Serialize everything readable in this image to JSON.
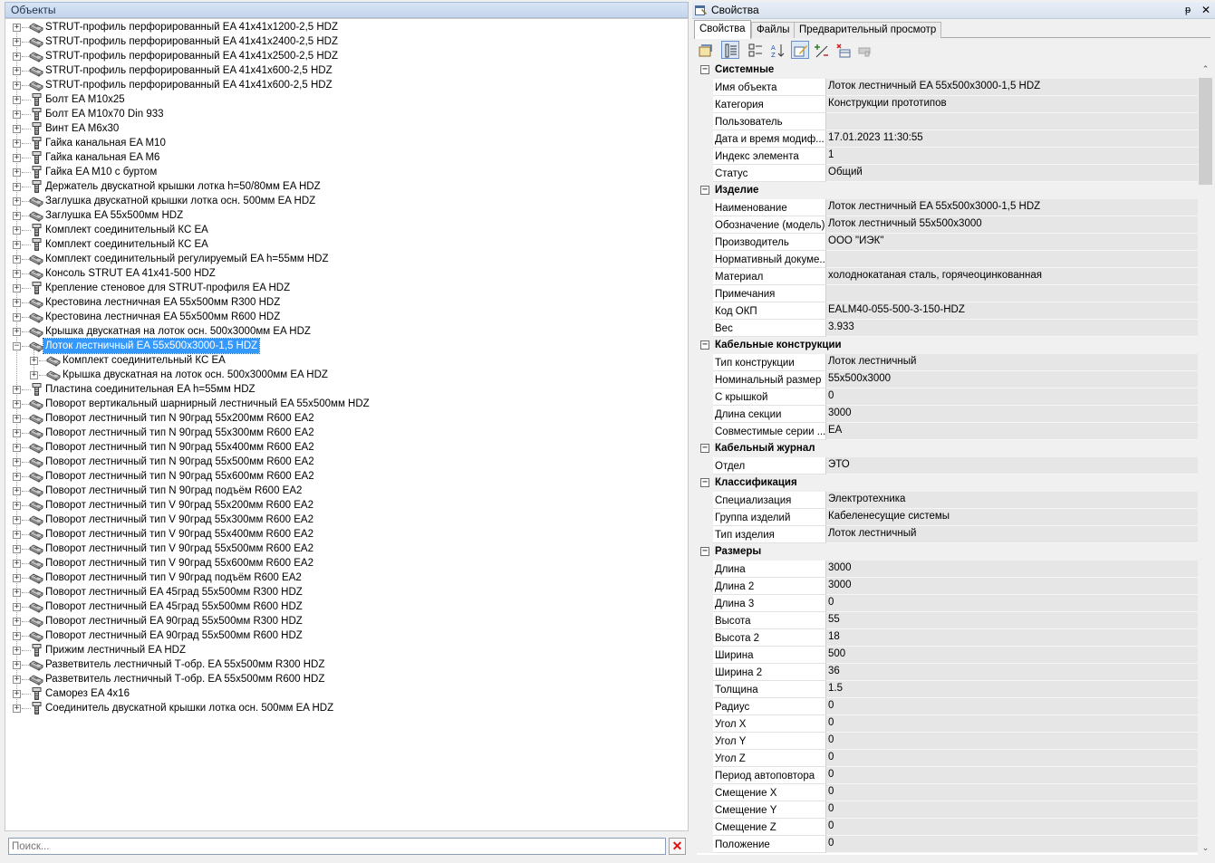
{
  "objects_panel": {
    "title": "Объекты",
    "search_placeholder": "Поиск...",
    "clear_symbol": "✕",
    "items": [
      {
        "label": "STRUT-профиль перфорированный EA 41x41x1200-2,5 HDZ",
        "icon": "profile-icon",
        "level": 0,
        "expand": "+"
      },
      {
        "label": "STRUT-профиль перфорированный EA 41x41x2400-2,5 HDZ",
        "icon": "profile-icon",
        "level": 0,
        "expand": "+"
      },
      {
        "label": "STRUT-профиль перфорированный EA 41x41x2500-2,5 HDZ",
        "icon": "profile-icon",
        "level": 0,
        "expand": "+"
      },
      {
        "label": "STRUT-профиль перфорированный EA 41x41x600-2,5 HDZ",
        "icon": "profile-icon",
        "level": 0,
        "expand": "+"
      },
      {
        "label": "STRUT-профиль перфорированный EA 41x41x600-2,5 HDZ",
        "icon": "profile-icon",
        "level": 0,
        "expand": "+"
      },
      {
        "label": "Болт EA M10x25",
        "icon": "fastener-icon",
        "level": 0,
        "expand": "+"
      },
      {
        "label": "Болт EA M10x70 Din  933",
        "icon": "fastener-icon",
        "level": 0,
        "expand": "+"
      },
      {
        "label": "Винт EA M6x30",
        "icon": "fastener-icon",
        "level": 0,
        "expand": "+"
      },
      {
        "label": "Гайка канальная EA M10",
        "icon": "fastener-icon",
        "level": 0,
        "expand": "+"
      },
      {
        "label": "Гайка канальная EA M6",
        "icon": "fastener-icon",
        "level": 0,
        "expand": "+"
      },
      {
        "label": "Гайка EA M10 с буртом",
        "icon": "fastener-icon",
        "level": 0,
        "expand": "+"
      },
      {
        "label": "Держатель двускатной крышки лотка h=50/80мм EA HDZ",
        "icon": "fastener-icon",
        "level": 0,
        "expand": "+"
      },
      {
        "label": "Заглушка двускатной крышки лотка осн. 500мм EA HDZ",
        "icon": "profile-icon",
        "level": 0,
        "expand": "+"
      },
      {
        "label": "Заглушка EA 55x500мм HDZ",
        "icon": "profile-icon",
        "level": 0,
        "expand": "+"
      },
      {
        "label": "Комплект соединительный КС EA",
        "icon": "fastener-icon",
        "level": 0,
        "expand": "+"
      },
      {
        "label": "Комплект соединительный КС EA",
        "icon": "fastener-icon",
        "level": 0,
        "expand": "+"
      },
      {
        "label": "Комплект соединительный регулируемый EA h=55мм HDZ",
        "icon": "profile-icon",
        "level": 0,
        "expand": "+"
      },
      {
        "label": "Консоль STRUT EA 41x41-500 HDZ",
        "icon": "profile-icon",
        "level": 0,
        "expand": "+"
      },
      {
        "label": "Крепление стеновое для STRUT-профиля EA HDZ",
        "icon": "fastener-icon",
        "level": 0,
        "expand": "+"
      },
      {
        "label": "Крестовина лестничная EA 55x500мм R300 HDZ",
        "icon": "profile-icon",
        "level": 0,
        "expand": "+"
      },
      {
        "label": "Крестовина лестничная EA 55x500мм R600 HDZ",
        "icon": "profile-icon",
        "level": 0,
        "expand": "+"
      },
      {
        "label": "Крышка двускатная на лоток осн. 500x3000мм EA HDZ",
        "icon": "profile-icon",
        "level": 0,
        "expand": "+"
      },
      {
        "label": "Лоток лестничный EA 55x500x3000-1,5 HDZ",
        "icon": "profile-icon",
        "level": 0,
        "expand": "−",
        "selected": true
      },
      {
        "label": "Комплект соединительный КС EA",
        "icon": "profile-icon",
        "level": 1,
        "expand": "+"
      },
      {
        "label": "Крышка двускатная на лоток осн. 500x3000мм EA HDZ",
        "icon": "profile-icon",
        "level": 1,
        "expand": "+"
      },
      {
        "label": "Пластина соединительная EA h=55мм HDZ",
        "icon": "fastener-icon",
        "level": 0,
        "expand": "+"
      },
      {
        "label": "Поворот вертикальный  шарнирный лестничный EA 55x500мм HDZ",
        "icon": "profile-icon",
        "level": 0,
        "expand": "+"
      },
      {
        "label": "Поворот лестничный тип N 90град  55x200мм R600 EA2",
        "icon": "profile-icon",
        "level": 0,
        "expand": "+"
      },
      {
        "label": "Поворот лестничный тип N 90град  55x300мм R600 EA2",
        "icon": "profile-icon",
        "level": 0,
        "expand": "+"
      },
      {
        "label": "Поворот лестничный тип N 90град  55x400мм R600 EA2",
        "icon": "profile-icon",
        "level": 0,
        "expand": "+"
      },
      {
        "label": "Поворот лестничный тип N 90град  55x500мм R600 EA2",
        "icon": "profile-icon",
        "level": 0,
        "expand": "+"
      },
      {
        "label": "Поворот лестничный тип N 90град  55x600мм R600 EA2",
        "icon": "profile-icon",
        "level": 0,
        "expand": "+"
      },
      {
        "label": "Поворот лестничный тип N 90град  подъём R600 EA2",
        "icon": "profile-icon",
        "level": 0,
        "expand": "+"
      },
      {
        "label": "Поворот лестничный тип V 90град  55x200мм R600 EA2",
        "icon": "profile-icon",
        "level": 0,
        "expand": "+"
      },
      {
        "label": "Поворот лестничный тип V 90град  55x300мм R600 EA2",
        "icon": "profile-icon",
        "level": 0,
        "expand": "+"
      },
      {
        "label": "Поворот лестничный тип V 90град  55x400мм R600 EA2",
        "icon": "profile-icon",
        "level": 0,
        "expand": "+"
      },
      {
        "label": "Поворот лестничный тип V 90град  55x500мм R600 EA2",
        "icon": "profile-icon",
        "level": 0,
        "expand": "+"
      },
      {
        "label": "Поворот лестничный тип V 90град  55x600мм R600 EA2",
        "icon": "profile-icon",
        "level": 0,
        "expand": "+"
      },
      {
        "label": "Поворот лестничный тип V 90град  подъём R600 EA2",
        "icon": "profile-icon",
        "level": 0,
        "expand": "+"
      },
      {
        "label": "Поворот лестничный EA 45град 55x500мм R300 HDZ",
        "icon": "profile-icon",
        "level": 0,
        "expand": "+"
      },
      {
        "label": "Поворот лестничный EA 45град 55x500мм R600 HDZ",
        "icon": "profile-icon",
        "level": 0,
        "expand": "+"
      },
      {
        "label": "Поворот лестничный EA 90град 55x500мм R300 HDZ",
        "icon": "profile-icon",
        "level": 0,
        "expand": "+"
      },
      {
        "label": "Поворот лестничный EA 90град 55x500мм R600 HDZ",
        "icon": "profile-icon",
        "level": 0,
        "expand": "+"
      },
      {
        "label": "Прижим лестничный EA HDZ",
        "icon": "fastener-icon",
        "level": 0,
        "expand": "+"
      },
      {
        "label": "Разветвитель лестничный Т-обр. EA 55x500мм R300 HDZ",
        "icon": "profile-icon",
        "level": 0,
        "expand": "+"
      },
      {
        "label": "Разветвитель лестничный Т-обр. EA 55x500мм R600 HDZ",
        "icon": "profile-icon",
        "level": 0,
        "expand": "+"
      },
      {
        "label": "Саморез EA 4x16",
        "icon": "fastener-icon",
        "level": 0,
        "expand": "+"
      },
      {
        "label": "Соединитель двускатной крышки лотка осн. 500мм EA HDZ",
        "icon": "fastener-icon",
        "level": 0,
        "expand": "+"
      }
    ]
  },
  "properties_panel": {
    "title": "Свойства",
    "pin_symbol": "ᵽ",
    "close_symbol": "✕",
    "tabs": [
      "Свойства",
      "Файлы",
      "Предварительный просмотр"
    ],
    "active_tab": 0,
    "toolbar": [
      "properties-icon",
      "categorized-icon",
      "grouped-icon",
      "sort-az-icon",
      "edit-icon",
      "add-remove-icon",
      "delete-icon",
      "disabled-icon"
    ],
    "categories": [
      {
        "name": "Системные",
        "expand": "−",
        "props": [
          {
            "name": "Имя объекта",
            "value": "Лоток лестничный EA 55x500x3000-1,5 HDZ"
          },
          {
            "name": "Категория",
            "value": "Конструкции прототипов"
          },
          {
            "name": "Пользователь",
            "value": ""
          },
          {
            "name": "Дата и время модиф...",
            "value": "17.01.2023 11:30:55"
          },
          {
            "name": "Индекс элемента",
            "value": "1"
          },
          {
            "name": "Статус",
            "value": "Общий"
          }
        ]
      },
      {
        "name": "Изделие",
        "expand": "−",
        "props": [
          {
            "name": "Наименование",
            "value": "Лоток лестничный EA 55x500x3000-1,5 HDZ"
          },
          {
            "name": "Обозначение (модель)",
            "value": "Лоток лестничный 55x500x3000"
          },
          {
            "name": "Производитель",
            "value": "ООО \"ИЭК\""
          },
          {
            "name": "Нормативный докуме...",
            "value": ""
          },
          {
            "name": "Материал",
            "value": "холоднокатаная сталь, горячеоцинкованная"
          },
          {
            "name": "Примечания",
            "value": ""
          },
          {
            "name": "Код ОКП",
            "value": "EALM40-055-500-3-150-HDZ"
          },
          {
            "name": "Вес",
            "value": "3.933"
          }
        ]
      },
      {
        "name": "Кабельные конструкции",
        "expand": "−",
        "props": [
          {
            "name": "Тип конструкции",
            "value": "Лоток лестничный"
          },
          {
            "name": "Номинальный размер",
            "value": "55x500x3000"
          },
          {
            "name": "С крышкой",
            "value": "0"
          },
          {
            "name": "Длина секции",
            "value": "3000"
          },
          {
            "name": "Совместимые серии ...",
            "value": "EA"
          }
        ]
      },
      {
        "name": "Кабельный журнал",
        "expand": "−",
        "props": [
          {
            "name": "Отдел",
            "value": "ЭТО"
          }
        ]
      },
      {
        "name": "Классификация",
        "expand": "−",
        "props": [
          {
            "name": "Специализация",
            "value": "Электротехника"
          },
          {
            "name": "Группа изделий",
            "value": "Кабеленесущие системы"
          },
          {
            "name": "Тип изделия",
            "value": "Лоток лестничный"
          }
        ]
      },
      {
        "name": "Размеры",
        "expand": "−",
        "props": [
          {
            "name": "Длина",
            "value": "3000"
          },
          {
            "name": "Длина 2",
            "value": "3000"
          },
          {
            "name": "Длина 3",
            "value": "0"
          },
          {
            "name": "Высота",
            "value": "55"
          },
          {
            "name": "Высота 2",
            "value": "18"
          },
          {
            "name": "Ширина",
            "value": "500"
          },
          {
            "name": "Ширина 2",
            "value": "36"
          },
          {
            "name": "Толщина",
            "value": "1.5"
          },
          {
            "name": "Радиус",
            "value": "0"
          },
          {
            "name": "Угол X",
            "value": "0"
          },
          {
            "name": "Угол Y",
            "value": "0"
          },
          {
            "name": "Угол Z",
            "value": "0"
          },
          {
            "name": "Период автоповтора",
            "value": "0"
          },
          {
            "name": "Смещение X",
            "value": "0"
          },
          {
            "name": "Смещение Y",
            "value": "0"
          },
          {
            "name": "Смещение Z",
            "value": "0"
          },
          {
            "name": "Положение",
            "value": "0"
          }
        ]
      }
    ]
  }
}
